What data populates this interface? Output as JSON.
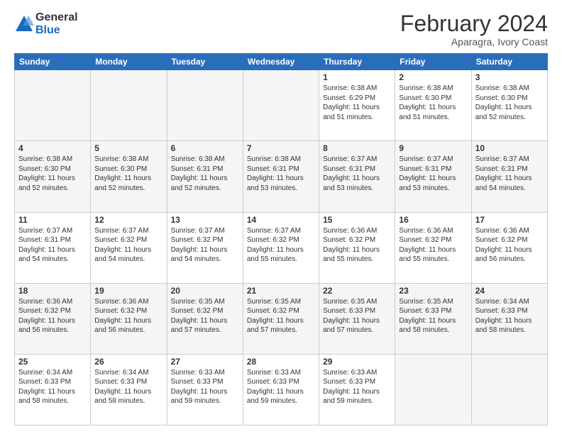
{
  "logo": {
    "general": "General",
    "blue": "Blue"
  },
  "header": {
    "title": "February 2024",
    "subtitle": "Aparagra, Ivory Coast"
  },
  "weekdays": [
    "Sunday",
    "Monday",
    "Tuesday",
    "Wednesday",
    "Thursday",
    "Friday",
    "Saturday"
  ],
  "weeks": [
    [
      {
        "day": "",
        "info": ""
      },
      {
        "day": "",
        "info": ""
      },
      {
        "day": "",
        "info": ""
      },
      {
        "day": "",
        "info": ""
      },
      {
        "day": "1",
        "info": "Sunrise: 6:38 AM\nSunset: 6:29 PM\nDaylight: 11 hours\nand 51 minutes."
      },
      {
        "day": "2",
        "info": "Sunrise: 6:38 AM\nSunset: 6:30 PM\nDaylight: 11 hours\nand 51 minutes."
      },
      {
        "day": "3",
        "info": "Sunrise: 6:38 AM\nSunset: 6:30 PM\nDaylight: 11 hours\nand 52 minutes."
      }
    ],
    [
      {
        "day": "4",
        "info": "Sunrise: 6:38 AM\nSunset: 6:30 PM\nDaylight: 11 hours\nand 52 minutes."
      },
      {
        "day": "5",
        "info": "Sunrise: 6:38 AM\nSunset: 6:30 PM\nDaylight: 11 hours\nand 52 minutes."
      },
      {
        "day": "6",
        "info": "Sunrise: 6:38 AM\nSunset: 6:31 PM\nDaylight: 11 hours\nand 52 minutes."
      },
      {
        "day": "7",
        "info": "Sunrise: 6:38 AM\nSunset: 6:31 PM\nDaylight: 11 hours\nand 53 minutes."
      },
      {
        "day": "8",
        "info": "Sunrise: 6:37 AM\nSunset: 6:31 PM\nDaylight: 11 hours\nand 53 minutes."
      },
      {
        "day": "9",
        "info": "Sunrise: 6:37 AM\nSunset: 6:31 PM\nDaylight: 11 hours\nand 53 minutes."
      },
      {
        "day": "10",
        "info": "Sunrise: 6:37 AM\nSunset: 6:31 PM\nDaylight: 11 hours\nand 54 minutes."
      }
    ],
    [
      {
        "day": "11",
        "info": "Sunrise: 6:37 AM\nSunset: 6:31 PM\nDaylight: 11 hours\nand 54 minutes."
      },
      {
        "day": "12",
        "info": "Sunrise: 6:37 AM\nSunset: 6:32 PM\nDaylight: 11 hours\nand 54 minutes."
      },
      {
        "day": "13",
        "info": "Sunrise: 6:37 AM\nSunset: 6:32 PM\nDaylight: 11 hours\nand 54 minutes."
      },
      {
        "day": "14",
        "info": "Sunrise: 6:37 AM\nSunset: 6:32 PM\nDaylight: 11 hours\nand 55 minutes."
      },
      {
        "day": "15",
        "info": "Sunrise: 6:36 AM\nSunset: 6:32 PM\nDaylight: 11 hours\nand 55 minutes."
      },
      {
        "day": "16",
        "info": "Sunrise: 6:36 AM\nSunset: 6:32 PM\nDaylight: 11 hours\nand 55 minutes."
      },
      {
        "day": "17",
        "info": "Sunrise: 6:36 AM\nSunset: 6:32 PM\nDaylight: 11 hours\nand 56 minutes."
      }
    ],
    [
      {
        "day": "18",
        "info": "Sunrise: 6:36 AM\nSunset: 6:32 PM\nDaylight: 11 hours\nand 56 minutes."
      },
      {
        "day": "19",
        "info": "Sunrise: 6:36 AM\nSunset: 6:32 PM\nDaylight: 11 hours\nand 56 minutes."
      },
      {
        "day": "20",
        "info": "Sunrise: 6:35 AM\nSunset: 6:32 PM\nDaylight: 11 hours\nand 57 minutes."
      },
      {
        "day": "21",
        "info": "Sunrise: 6:35 AM\nSunset: 6:32 PM\nDaylight: 11 hours\nand 57 minutes."
      },
      {
        "day": "22",
        "info": "Sunrise: 6:35 AM\nSunset: 6:33 PM\nDaylight: 11 hours\nand 57 minutes."
      },
      {
        "day": "23",
        "info": "Sunrise: 6:35 AM\nSunset: 6:33 PM\nDaylight: 11 hours\nand 58 minutes."
      },
      {
        "day": "24",
        "info": "Sunrise: 6:34 AM\nSunset: 6:33 PM\nDaylight: 11 hours\nand 58 minutes."
      }
    ],
    [
      {
        "day": "25",
        "info": "Sunrise: 6:34 AM\nSunset: 6:33 PM\nDaylight: 11 hours\nand 58 minutes."
      },
      {
        "day": "26",
        "info": "Sunrise: 6:34 AM\nSunset: 6:33 PM\nDaylight: 11 hours\nand 58 minutes."
      },
      {
        "day": "27",
        "info": "Sunrise: 6:33 AM\nSunset: 6:33 PM\nDaylight: 11 hours\nand 59 minutes."
      },
      {
        "day": "28",
        "info": "Sunrise: 6:33 AM\nSunset: 6:33 PM\nDaylight: 11 hours\nand 59 minutes."
      },
      {
        "day": "29",
        "info": "Sunrise: 6:33 AM\nSunset: 6:33 PM\nDaylight: 11 hours\nand 59 minutes."
      },
      {
        "day": "",
        "info": ""
      },
      {
        "day": "",
        "info": ""
      }
    ]
  ]
}
